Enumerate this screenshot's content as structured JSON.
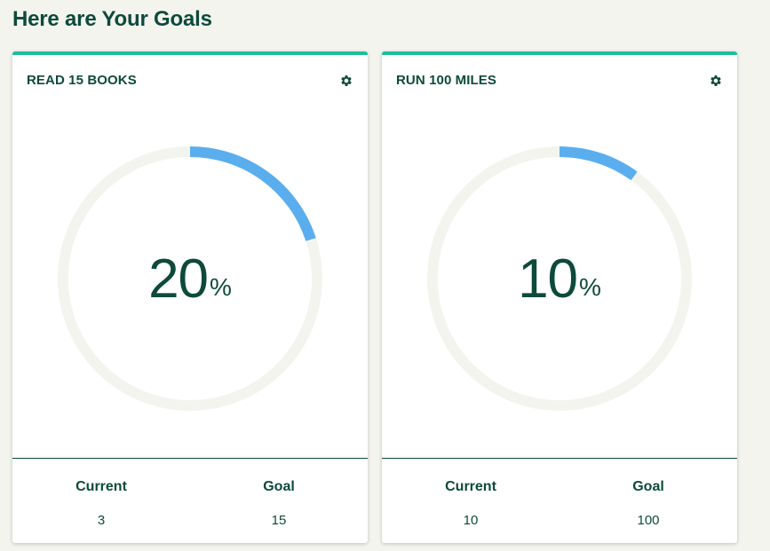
{
  "page": {
    "title": "Here are Your Goals"
  },
  "colors": {
    "accent": "#1cbf9c",
    "progress": "#5aaeee",
    "track": "#f4f4ef",
    "text": "#0d4a3b"
  },
  "goals": [
    {
      "title": "READ 15 BOOKS",
      "percent_value": "20",
      "percent_sign": "%",
      "progress": 0.2,
      "current_label": "Current",
      "current_value": "3",
      "goal_label": "Goal",
      "goal_value": "15",
      "settings_icon": "gear-icon"
    },
    {
      "title": "RUN 100 MILES",
      "percent_value": "10",
      "percent_sign": "%",
      "progress": 0.1,
      "current_label": "Current",
      "current_value": "10",
      "goal_label": "Goal",
      "goal_value": "100",
      "settings_icon": "gear-icon"
    }
  ]
}
